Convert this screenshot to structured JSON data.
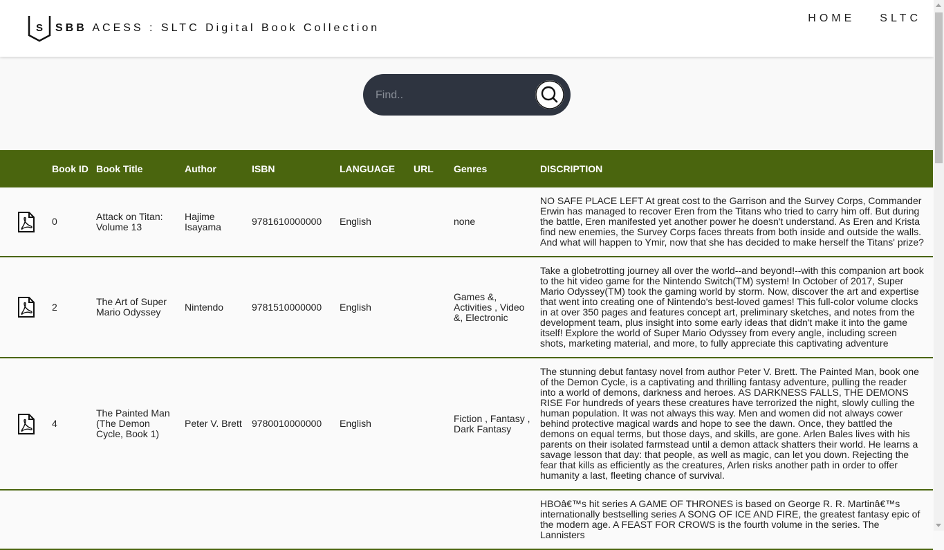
{
  "header": {
    "logo_letter": "S",
    "brand_strong": "SBB",
    "brand_rest": "ACESS : SLTC Digital Book Collection",
    "nav": [
      "HOME",
      "SLTC"
    ]
  },
  "search": {
    "placeholder": "Find.."
  },
  "table": {
    "columns": [
      "",
      "Book ID",
      "Book Title",
      "Author",
      "ISBN",
      "LANGUAGE",
      "URL",
      "Genres",
      "DISCRIPTION"
    ],
    "rows": [
      {
        "id": "0",
        "title": "Attack on Titan: Volume 13",
        "author": "Hajime Isayama",
        "isbn": "9781610000000",
        "language": "English",
        "url": "",
        "genres": "none",
        "description": "NO SAFE PLACE LEFT At great cost to the Garrison and the Survey Corps, Commander Erwin has managed to recover Eren from the Titans who tried to carry him off. But during the battle, Eren manifested yet another power he doesn't understand. As Eren and Krista find new enemies, the Survey Corps faces threats from both inside and outside the walls. And what will happen to Ymir, now that she has decided to make herself the Titans' prize?"
      },
      {
        "id": "2",
        "title": "The Art of Super Mario Odyssey",
        "author": "Nintendo",
        "isbn": "9781510000000",
        "language": "English",
        "url": "",
        "genres": "Games &, Activities , Video &, Electronic",
        "description": "Take a globetrotting journey all over the world--and beyond!--with this companion art book to the hit video game for the Nintendo Switch(TM) system! In October of 2017, Super Mario Odyssey(TM) took the gaming world by storm. Now, discover the art and expertise that went into creating one of Nintendo's best-loved games! This full-color volume clocks in at over 350 pages and features concept art, preliminary sketches, and notes from the development team, plus insight into some early ideas that didn't make it into the game itself! Explore the world of Super Mario Odyssey from every angle, including screen shots, marketing material, and more, to fully appreciate this captivating adventure"
      },
      {
        "id": "4",
        "title": "The Painted Man (The Demon Cycle, Book 1)",
        "author": "Peter V. Brett",
        "isbn": "9780010000000",
        "language": "English",
        "url": "",
        "genres": "Fiction , Fantasy , Dark Fantasy",
        "description": "The stunning debut fantasy novel from author Peter V. Brett. The Painted Man, book one of the Demon Cycle, is a captivating and thrilling fantasy adventure, pulling the reader into a world of demons, darkness and heroes. AS DARKNESS FALLS, THE DEMONS RISE For hundreds of years these creatures have terrorized the night, slowly culling the human population. It was not always this way. Men and women did not always cower behind protective magical wards and hope to see the dawn. Once, they battled the demons on equal terms, but those days, and skills, are gone. Arlen Bales lives with his parents on their isolated farmstead until a demon attack shatters their world. He learns a savage lesson that day: that people, as well as magic, can let you down. Rejecting the fear that kills as efficiently as the creatures, Arlen risks another path in order to offer humanity a last, fleeting chance of survival."
      },
      {
        "id": "",
        "title": "",
        "author": "",
        "isbn": "",
        "language": "",
        "url": "",
        "genres": "",
        "description": "HBOâ€™s hit series A GAME OF THRONES is based on George R. R. Martinâ€™s internationally bestselling series A SONG OF ICE AND FIRE, the greatest fantasy epic of the modern age. A FEAST FOR CROWS is the fourth volume in the series. The Lannisters"
      }
    ]
  },
  "colors": {
    "header_bar": "#4a650e",
    "search_bg": "#2e3440"
  }
}
